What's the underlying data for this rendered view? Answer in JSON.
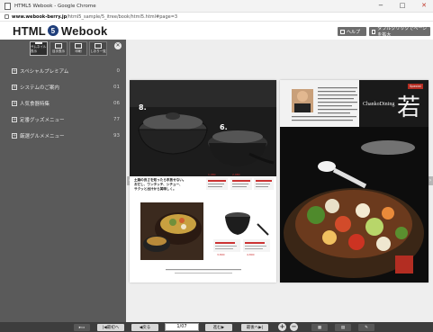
{
  "window": {
    "title": "HTML5 Webook - Google Chrome",
    "minimize": "−",
    "maximize": "□",
    "close": "✕"
  },
  "address": {
    "domain": "www.webook-berry.jp",
    "path": "/html5_sample/5_itree/book/html5.html#page=3"
  },
  "header": {
    "logo_pre": "HTML",
    "logo_num": "5",
    "logo_post": "Webook",
    "help_label": "ヘルプ",
    "double_click_label": "ダブルクリックでページを拡大"
  },
  "sidebar": {
    "tabs": [
      {
        "label": "サムネイル表示",
        "active": true
      },
      {
        "label": "目次表示",
        "active": false
      },
      {
        "label": "印刷",
        "active": false
      },
      {
        "label": "しおり一覧",
        "active": false
      }
    ],
    "close": "✕",
    "items": [
      {
        "label": "スペシャルプレミアム",
        "count": "0"
      },
      {
        "label": "システムのご案内",
        "count": "01"
      },
      {
        "label": "人気食器特集",
        "count": "06"
      },
      {
        "label": "定番グッズメニュー",
        "count": "77"
      },
      {
        "label": "厳選グルメメニュー",
        "count": "93"
      }
    ]
  },
  "viewer": {
    "left_arrow": "‹",
    "right_arrow": "›",
    "left_page": {
      "badge_1": "8.",
      "badge_2": "6.",
      "headline": "土鍋の良さを知ったら手放せない。\nおだし、ワンタッチ、シチュー、\nサクッと出汁から美味しく。",
      "price_tags": [
        "1,980",
        "2,980",
        "3,800",
        "4,800"
      ]
    },
    "right_page": {
      "brand": "ChankoDining",
      "kanji": "若",
      "tag": "Special"
    }
  },
  "bottombar": {
    "first_label": "最初へ",
    "prev_label": "戻る",
    "page_indicator": "1/07",
    "next_label": "進む",
    "last_label": "最後へ",
    "zoom_in": "+",
    "zoom_out": "−"
  },
  "colors": {
    "sidebar_bg": "#5a5a5a",
    "viewer_bg": "#eeeeee",
    "logo_badge": "#1f3e7a",
    "bottombar_bg": "#3d3d3d"
  }
}
